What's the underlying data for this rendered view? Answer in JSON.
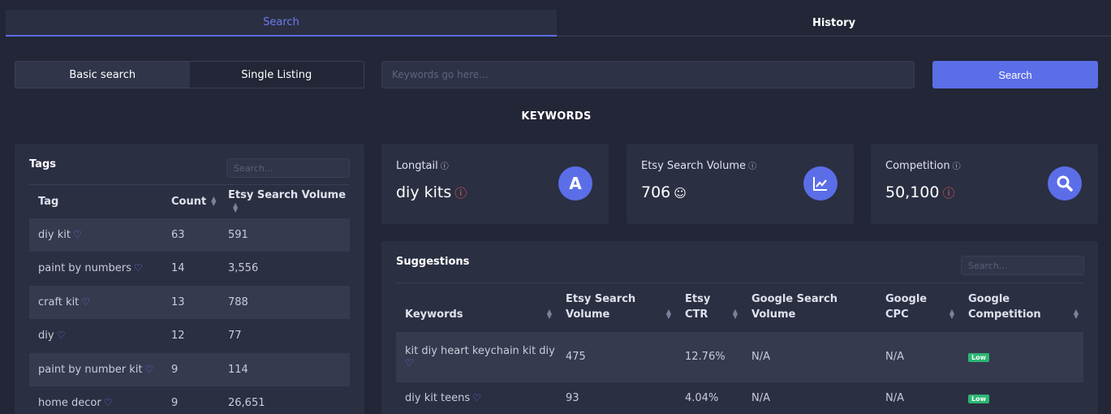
{
  "tabs": {
    "search": "Search",
    "history": "History"
  },
  "mode": {
    "basic": "Basic search",
    "single": "Single Listing"
  },
  "keyword_input": {
    "placeholder": "Keywords go here..."
  },
  "search_button": "Search",
  "section_title": "KEYWORDS",
  "tags": {
    "title": "Tags",
    "search_placeholder": "Search...",
    "columns": [
      "Tag",
      "Count",
      "Etsy Search Volume"
    ],
    "rows": [
      {
        "tag": "diy kit",
        "count": "63",
        "volume": "591"
      },
      {
        "tag": "paint by numbers",
        "count": "14",
        "volume": "3,556"
      },
      {
        "tag": "craft kit",
        "count": "13",
        "volume": "788"
      },
      {
        "tag": "diy",
        "count": "12",
        "volume": "77"
      },
      {
        "tag": "paint by number kit",
        "count": "9",
        "volume": "114"
      },
      {
        "tag": "home decor",
        "count": "9",
        "volume": "26,651"
      }
    ]
  },
  "cards": {
    "longtail": {
      "label": "Longtail",
      "value": "diy kits",
      "icon": "letter-a-icon"
    },
    "volume": {
      "label": "Etsy Search Volume",
      "value": "706",
      "icon": "chart-icon"
    },
    "competition": {
      "label": "Competition",
      "value": "50,100",
      "icon": "search-icon"
    }
  },
  "suggestions": {
    "title": "Suggestions",
    "search_placeholder": "Search...",
    "columns": {
      "keywords": "Keywords",
      "volume_1": "Etsy Search",
      "volume_2": "Volume",
      "ctr_1": "Etsy",
      "ctr_2": "CTR",
      "gvol_1": "Google Search",
      "gvol_2": "Volume",
      "cpc_1": "Google",
      "cpc_2": "CPC",
      "gcomp_1": "Google",
      "gcomp_2": "Competition"
    },
    "rows": [
      {
        "keyword": "kit diy heart keychain kit diy",
        "volume": "475",
        "ctr": "12.76%",
        "gvol": "N/A",
        "cpc": "N/A",
        "gcomp": "Low"
      },
      {
        "keyword": "diy kit teens",
        "volume": "93",
        "ctr": "4.04%",
        "gvol": "N/A",
        "cpc": "N/A",
        "gcomp": "Low"
      }
    ]
  },
  "colors": {
    "accent": "#5b6ee8",
    "background": "#222636",
    "panel": "#2b2f42",
    "warning": "#e35a5a",
    "badge_low": "#2bb673"
  }
}
